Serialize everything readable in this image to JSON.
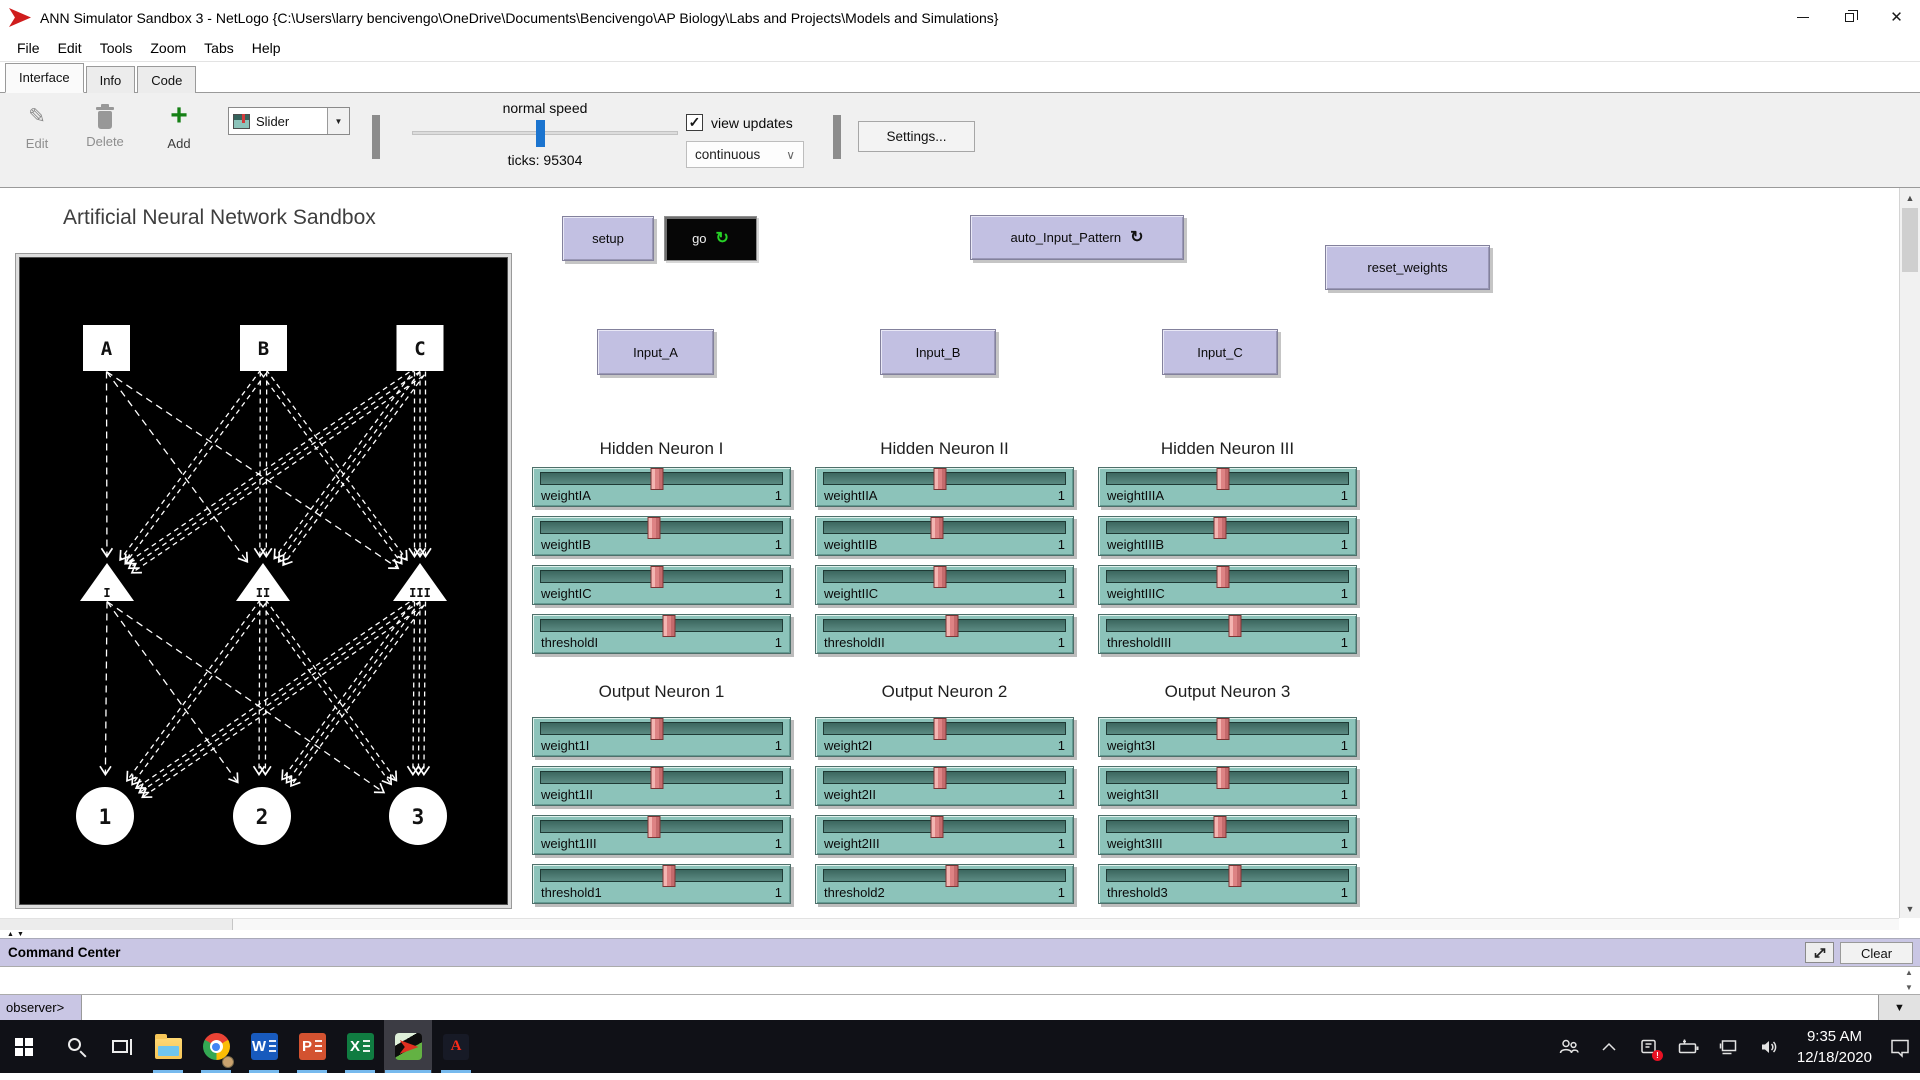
{
  "window": {
    "title": "ANN Simulator Sandbox 3 - NetLogo {C:\\Users\\larry bencivengo\\OneDrive\\Documents\\Bencivengo\\AP Biology\\Labs and Projects\\Models and Simulations}"
  },
  "menu": {
    "items": [
      "File",
      "Edit",
      "Tools",
      "Zoom",
      "Tabs",
      "Help"
    ]
  },
  "tabs": [
    "Interface",
    "Info",
    "Code"
  ],
  "toolbar": {
    "edit_label": "Edit",
    "delete_label": "Delete",
    "add_label": "Add",
    "widget_chooser_value": "Slider",
    "speed_label": "normal speed",
    "ticks_label": "ticks: 95304",
    "view_updates_label": "view updates",
    "view_updates_checked": true,
    "update_mode_value": "continuous",
    "settings_label": "Settings..."
  },
  "workspace": {
    "title": "Artificial Neural Network Sandbox",
    "buttons": {
      "setup": {
        "label": "setup"
      },
      "go": {
        "label": "go",
        "forever": true
      },
      "auto_input_pattern": {
        "label": "auto_Input_Pattern",
        "forever": true
      },
      "reset_weights": {
        "label": "reset_weights"
      },
      "input_a": {
        "label": "Input_A"
      },
      "input_b": {
        "label": "Input_B"
      },
      "input_c": {
        "label": "Input_C"
      }
    },
    "view": {
      "network": {
        "inputs": [
          "A",
          "B",
          "C"
        ],
        "hidden": [
          "I",
          "II",
          "III"
        ],
        "outputs": [
          "1",
          "2",
          "3"
        ]
      }
    },
    "slider_groups": [
      {
        "title": "Hidden Neuron I",
        "sliders": [
          {
            "label": "weightIA",
            "value": "1",
            "pos": 48
          },
          {
            "label": "weightIB",
            "value": "1",
            "pos": 47
          },
          {
            "label": "weightIC",
            "value": "1",
            "pos": 48
          },
          {
            "label": "thresholdI",
            "value": "1",
            "pos": 53
          }
        ]
      },
      {
        "title": "Hidden Neuron II",
        "sliders": [
          {
            "label": "weightIIA",
            "value": "1",
            "pos": 48
          },
          {
            "label": "weightIIB",
            "value": "1",
            "pos": 47
          },
          {
            "label": "weightIIC",
            "value": "1",
            "pos": 48
          },
          {
            "label": "thresholdII",
            "value": "1",
            "pos": 53
          }
        ]
      },
      {
        "title": "Hidden Neuron III",
        "sliders": [
          {
            "label": "weightIIIA",
            "value": "1",
            "pos": 48
          },
          {
            "label": "weightIIIB",
            "value": "1",
            "pos": 47
          },
          {
            "label": "weightIIIC",
            "value": "1",
            "pos": 48
          },
          {
            "label": "thresholdIII",
            "value": "1",
            "pos": 53
          }
        ]
      },
      {
        "title": "Output Neuron 1",
        "sliders": [
          {
            "label": "weight1I",
            "value": "1",
            "pos": 48
          },
          {
            "label": "weight1II",
            "value": "1",
            "pos": 48
          },
          {
            "label": "weight1III",
            "value": "1",
            "pos": 47
          },
          {
            "label": "threshold1",
            "value": "1",
            "pos": 53
          }
        ]
      },
      {
        "title": "Output Neuron 2",
        "sliders": [
          {
            "label": "weight2I",
            "value": "1",
            "pos": 48
          },
          {
            "label": "weight2II",
            "value": "1",
            "pos": 48
          },
          {
            "label": "weight2III",
            "value": "1",
            "pos": 47
          },
          {
            "label": "threshold2",
            "value": "1",
            "pos": 53
          }
        ]
      },
      {
        "title": "Output Neuron 3",
        "sliders": [
          {
            "label": "weight3I",
            "value": "1",
            "pos": 48
          },
          {
            "label": "weight3II",
            "value": "1",
            "pos": 48
          },
          {
            "label": "weight3III",
            "value": "1",
            "pos": 47
          },
          {
            "label": "threshold3",
            "value": "1",
            "pos": 53
          }
        ]
      }
    ]
  },
  "command_center": {
    "title": "Command Center",
    "clear_label": "Clear",
    "prompt": "observer>",
    "input_value": ""
  },
  "taskbar": {
    "clock": {
      "time": "9:35 AM",
      "date": "12/18/2020"
    },
    "app_letters": {
      "word": "W",
      "powerpoint": "P",
      "excel": "X",
      "acrobat": "A"
    }
  },
  "colors": {
    "button_purple": "#c2c0e2",
    "slider_teal": "#8cc3ba",
    "slider_handle_pink": "#dd8384",
    "go_forever_green": "#27d227",
    "taskbar_indicator_blue": "#76b9ed",
    "netlogo_logo_red": "#cf1d1d"
  }
}
